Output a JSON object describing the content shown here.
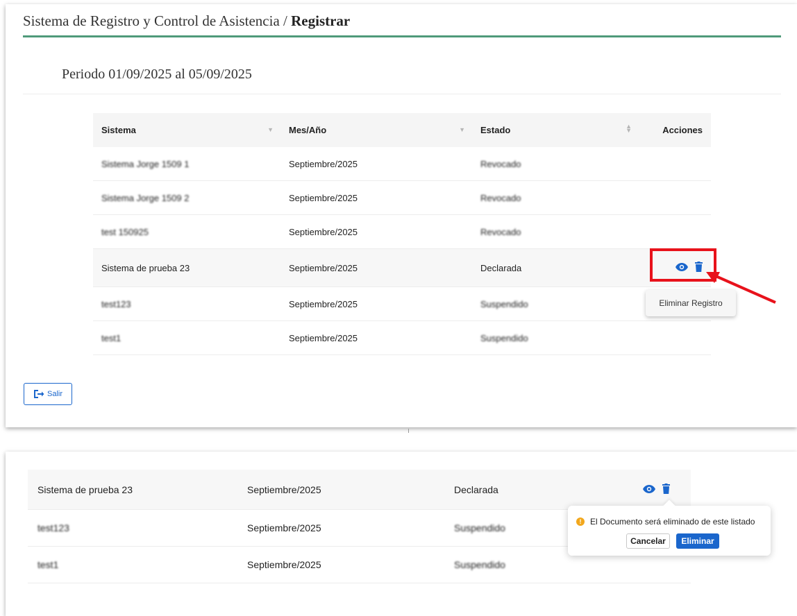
{
  "breadcrumb": {
    "app": "Sistema de Registro y Control de Asistencia /",
    "current": "Registrar"
  },
  "period": "Periodo 01/09/2025 al 05/09/2025",
  "table": {
    "headers": {
      "sistema": "Sistema",
      "mes": "Mes/Año",
      "estado": "Estado",
      "acciones": "Acciones"
    },
    "rows": [
      {
        "sistema": "Sistema Jorge 1509 1",
        "mes": "Septiembre/2025",
        "estado": "Revocado"
      },
      {
        "sistema": "Sistema Jorge 1509 2",
        "mes": "Septiembre/2025",
        "estado": "Revocado"
      },
      {
        "sistema": "test 150925",
        "mes": "Septiembre/2025",
        "estado": "Revocado"
      },
      {
        "sistema": "Sistema de prueba 23",
        "mes": "Septiembre/2025",
        "estado": "Declarada"
      },
      {
        "sistema": "test123",
        "mes": "Septiembre/2025",
        "estado": "Suspendido"
      },
      {
        "sistema": "test1",
        "mes": "Septiembre/2025",
        "estado": "Suspendido"
      }
    ]
  },
  "tooltip": "Eliminar Registro",
  "exit_button": "Salir",
  "panel2": {
    "rows": [
      {
        "sistema": "Sistema de prueba 23",
        "mes": "Septiembre/2025",
        "estado": "Declarada"
      },
      {
        "sistema": "test123",
        "mes": "Septiembre/2025",
        "estado": "Suspendido"
      },
      {
        "sistema": "test1",
        "mes": "Septiembre/2025",
        "estado": "Suspendido"
      }
    ]
  },
  "confirm": {
    "message": "El Documento será eliminado de este listado",
    "cancel": "Cancelar",
    "confirm": "Eliminar"
  },
  "colors": {
    "accent_green": "#4f9a7a",
    "primary_blue": "#1a66cc",
    "highlight_red": "#e8121b",
    "warning": "#f2a71c"
  }
}
